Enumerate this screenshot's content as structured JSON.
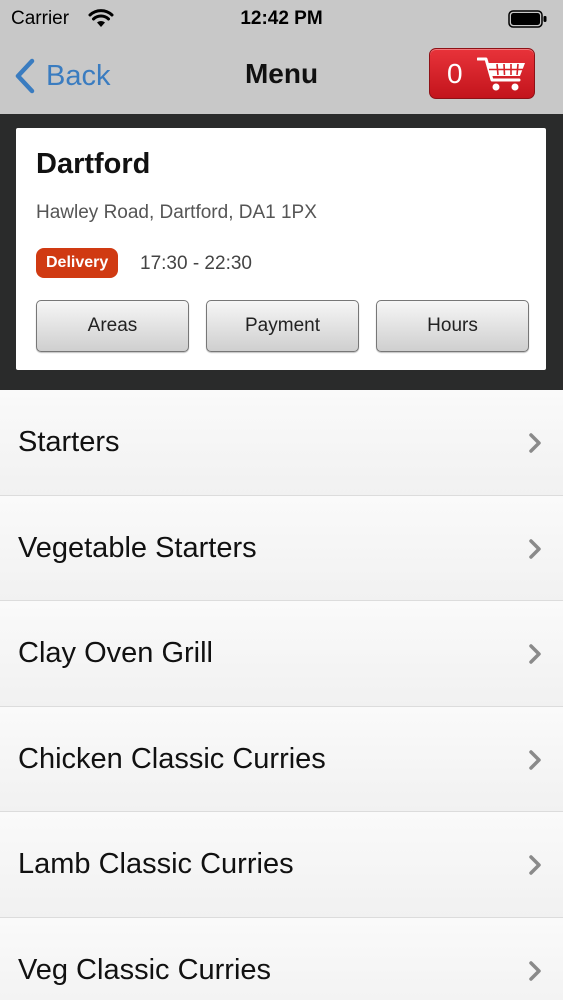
{
  "status_bar": {
    "carrier": "Carrier",
    "time": "12:42 PM",
    "wifi_icon": "wifi-icon",
    "battery_icon": "battery-icon"
  },
  "nav": {
    "back_label": "Back",
    "title": "Menu",
    "cart_count": "0",
    "cart_icon": "shopping-cart-icon",
    "accent_color": "#3a7cc0",
    "cart_color": "#d62027"
  },
  "store": {
    "name": "Dartford",
    "address": "Hawley Road, Dartford, DA1 1PX",
    "badge": "Delivery",
    "badge_color": "#d03a12",
    "hours": "17:30 - 22:30",
    "buttons": [
      {
        "label": "Areas"
      },
      {
        "label": "Payment"
      },
      {
        "label": "Hours"
      }
    ]
  },
  "menu": {
    "chevron_icon": "chevron-right-icon",
    "items": [
      {
        "label": "Starters"
      },
      {
        "label": "Vegetable Starters"
      },
      {
        "label": "Clay Oven Grill"
      },
      {
        "label": "Chicken Classic Curries"
      },
      {
        "label": "Lamb Classic Curries"
      },
      {
        "label": "Veg Classic Curries"
      }
    ]
  }
}
